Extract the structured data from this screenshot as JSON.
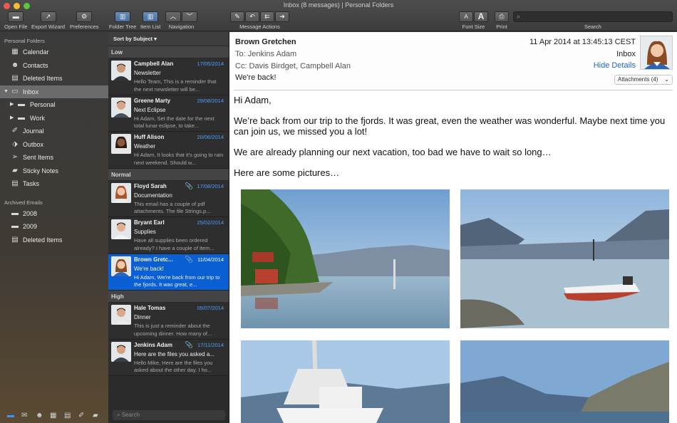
{
  "window": {
    "title": "Inbox (8 messages) | Personal Folders"
  },
  "toolbar": {
    "open_file": "Open File",
    "export_wizard": "Export Wizard",
    "preferences": "Preferences",
    "folder_tree": "Folder Tree",
    "item_list": "Item List",
    "navigation": "Navigation",
    "message_actions": "Message Actions",
    "font_size": "Font Size",
    "print": "Print",
    "search": "Search"
  },
  "sidebar": {
    "personal_header": "Personal Folders",
    "items": [
      {
        "label": "Calendar"
      },
      {
        "label": "Contacts"
      },
      {
        "label": "Deleted Items"
      },
      {
        "label": "Inbox"
      },
      {
        "label": "Personal"
      },
      {
        "label": "Work"
      },
      {
        "label": "Journal"
      },
      {
        "label": "Outbox"
      },
      {
        "label": "Sent Items"
      },
      {
        "label": "Sticky Notes"
      },
      {
        "label": "Tasks"
      }
    ],
    "archived_header": "Archived Emails",
    "archived": [
      {
        "label": "2008"
      },
      {
        "label": "2009"
      },
      {
        "label": "Deleted Items"
      }
    ]
  },
  "list": {
    "sort_label": "Sort by Subject ▾",
    "groups": {
      "low": "Low",
      "normal": "Normal",
      "high": "High"
    },
    "messages": [
      {
        "from": "Campbell Alan",
        "date": "17/05/2014",
        "subject": "Newsletter",
        "preview": "Hello Team, This is a reminder that the next newsletter will be..."
      },
      {
        "from": "Greene Marty",
        "date": "29/08/2014",
        "subject": "Next Eclipse",
        "preview": "Hi Adam, Set the date for the next total lunar eclipse, to take..."
      },
      {
        "from": "Huff Alison",
        "date": "20/06/2014",
        "subject": "Weather",
        "preview": "Hi Adam, It looks that it's going to rain next weekend. Should w..."
      },
      {
        "from": "Floyd Sarah",
        "date": "17/08/2014",
        "subject": "Documentation",
        "preview": "This email has a couple of pdf attachments. The file Strings.p..."
      },
      {
        "from": "Bryant Earl",
        "date": "25/02/2014",
        "subject": "Supplies",
        "preview": "Have all supplies been ordered already? I have a couple of item..."
      },
      {
        "from": "Brown Gretc...",
        "date": "11/04/2014",
        "subject": "We're back!",
        "preview": "Hi Adam, We're back from our trip to the fjords. It was great, e..."
      },
      {
        "from": "Hale Tomas",
        "date": "05/07/2014",
        "subject": "Dinner",
        "preview": "This is just a reminder about the upcoming dinner. How many of..."
      },
      {
        "from": "Jenkins Adam",
        "date": "17/11/2014",
        "subject": "Here are the files you asked a...",
        "preview": "Hello Mike, Here are the files you asked about the other day. I ho..."
      }
    ],
    "search_placeholder": "Search"
  },
  "reader": {
    "from": "Brown Gretchen",
    "to": "To: Jenkins Adam",
    "cc": "Cc: Davis Birdget,    Campbell Alan",
    "subject": "We're back!",
    "datetime": "11 Apr 2014 at 13:45:13 CEST",
    "folder": "Inbox",
    "hide_details": "Hide Details",
    "attachments": "Attachments (4)",
    "body": [
      "Hi Adam,",
      "We’re back from our trip to the fjords. It was great, even the weather was wonderful. Maybe next time you can join us, we missed you a lot!",
      "We are already planning our next vacation, too bad we have to wait so long…",
      "Here are some pictures…"
    ]
  },
  "colors": {
    "accent": "#0a60d2",
    "date_blue": "#4aa0ff",
    "link": "#1a66d0"
  }
}
